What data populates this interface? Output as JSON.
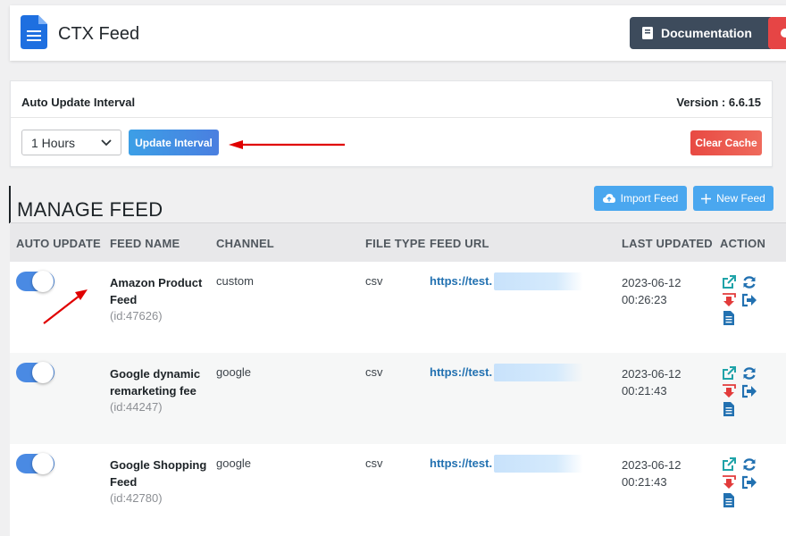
{
  "header": {
    "app_title": "CTX Feed",
    "documentation_label": "Documentation"
  },
  "auto_update": {
    "title": "Auto Update Interval",
    "version": "Version : 6.6.15",
    "selected_interval": "1 Hours",
    "update_button": "Update Interval",
    "clear_cache_button": "Clear Cache"
  },
  "manage_feed": {
    "title": "MANAGE FEED",
    "import_button": "Import Feed",
    "new_button": "New Feed"
  },
  "table": {
    "headers": [
      "AUTO UPDATE",
      "FEED NAME",
      "CHANNEL",
      "FILE TYPE",
      "FEED URL",
      "LAST UPDATED",
      "ACTION"
    ],
    "rows": [
      {
        "auto_update": true,
        "name": "Amazon Product Feed",
        "id": "(id:47626)",
        "channel": "custom",
        "file_type": "csv",
        "url": "https://test.",
        "date": "2023-06-12",
        "time": "00:26:23"
      },
      {
        "auto_update": true,
        "name": "Google dynamic remarketing fee",
        "id": "(id:44247)",
        "channel": "google",
        "file_type": "csv",
        "url": "https://test.",
        "date": "2023-06-12",
        "time": "00:21:43"
      },
      {
        "auto_update": true,
        "name": "Google Shopping Feed",
        "id": "(id:42780)",
        "channel": "google",
        "file_type": "csv",
        "url": "https://test.",
        "date": "2023-06-12",
        "time": "00:21:43"
      }
    ]
  },
  "colors": {
    "accent": "#4a8ae3",
    "link": "#2271b1",
    "danger": "#e84a43",
    "annotation_arrow": "#e00000"
  },
  "icons": [
    "document-icon",
    "book-icon",
    "chevron-down-icon",
    "cloud-upload-icon",
    "plus-icon",
    "external-link-icon",
    "refresh-icon",
    "download-icon",
    "sign-out-icon",
    "file-icon"
  ]
}
